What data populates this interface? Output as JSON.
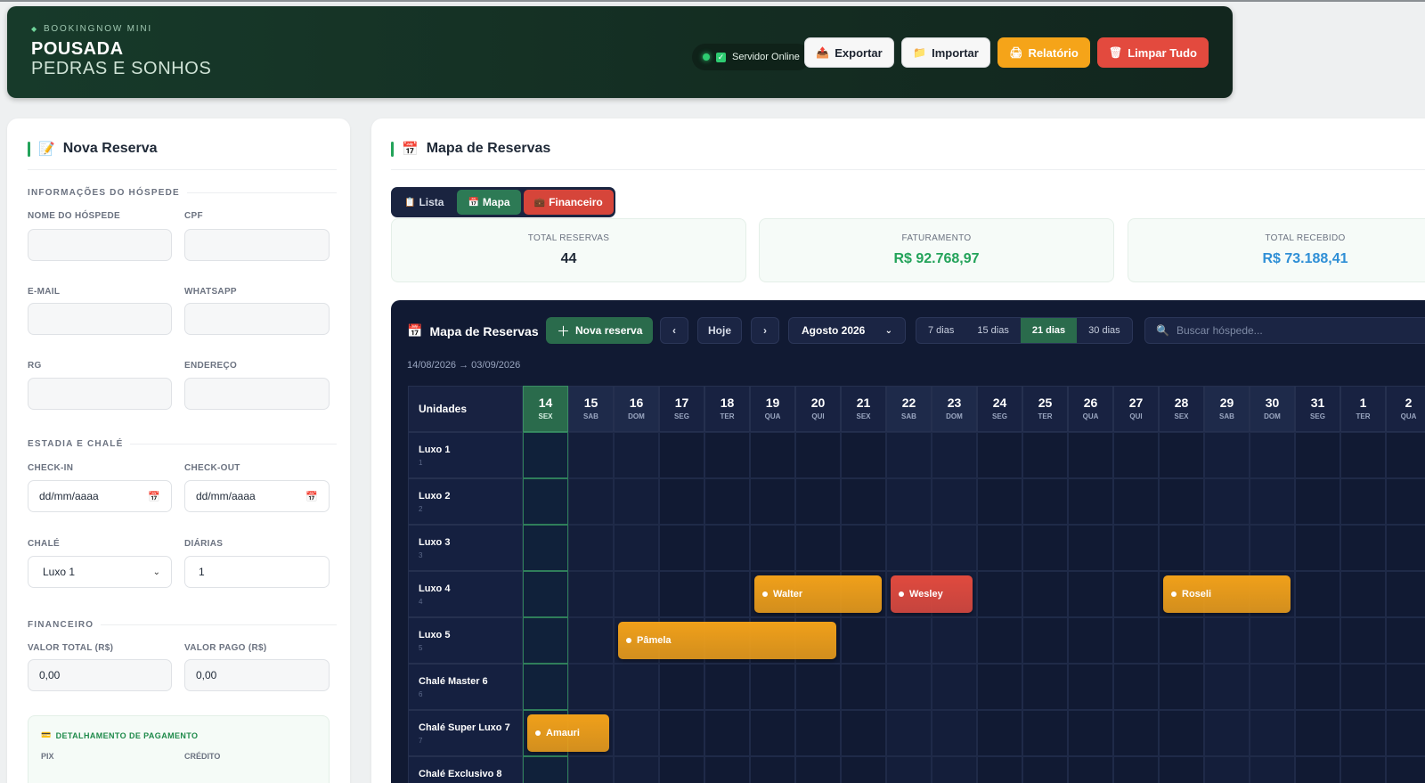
{
  "header": {
    "brand_sub": "BOOKINGNOW MINI",
    "title_line1": "POUSADA",
    "title_line2": "PEDRAS E SONHOS",
    "server_status": "Servidor Online",
    "buttons": {
      "export": "Exportar",
      "import": "Importar",
      "report": "Relatório",
      "clear": "Limpar Tudo"
    },
    "colors": {
      "orange": "#f5a419",
      "red": "#e34a3e",
      "bg": "#173a2a"
    }
  },
  "form": {
    "title": "Nova Reserva",
    "guest_section": "INFORMAÇÕES DO HÓSPEDE",
    "labels": {
      "name": "NOME DO HÓSPEDE",
      "cpf": "CPF",
      "email": "E-MAIL",
      "whatsapp": "WHATSAPP",
      "rg": "RG",
      "address": "ENDEREÇO",
      "checkin": "CHECK-IN",
      "checkout": "CHECK-OUT",
      "chalet": "CHALÉ",
      "nights": "DIÁRIAS",
      "total_value": "VALOR TOTAL (R$)",
      "paid_value": "VALOR PAGO (R$)"
    },
    "stay_section": "ESTADIA E CHALÉ",
    "finance_section": "FINANCEIRO",
    "values": {
      "checkin": "dd/mm/aaaa",
      "checkout": "dd/mm/aaaa",
      "chalet": "Luxo 1",
      "nights": "1",
      "total_value": "0,00",
      "paid_value": "0,00"
    },
    "payment": {
      "title": "DETALHAMENTO DE PAGAMENTO",
      "col_pix": "PIX",
      "col_credit": "CRÉDITO"
    }
  },
  "main": {
    "title": "Mapa de Reservas",
    "tabs": [
      {
        "label": "Lista"
      },
      {
        "label": "Mapa"
      },
      {
        "label": "Financeiro"
      }
    ],
    "stats": [
      {
        "label": "TOTAL RESERVAS",
        "value": "44",
        "color": "#1f2937"
      },
      {
        "label": "FATURAMENTO",
        "value": "R$ 92.768,97",
        "color": "#23a35a"
      },
      {
        "label": "TOTAL RECEBIDO",
        "value": "R$ 73.188,41",
        "color": "#2f8fd6"
      }
    ]
  },
  "map": {
    "title": "Mapa de Reservas",
    "new_button": "Nova reserva",
    "prev": "‹",
    "today": "Hoje",
    "next": "›",
    "month": "Agosto 2026",
    "ranges": [
      "7 dias",
      "15 dias",
      "21 dias",
      "30 dias"
    ],
    "active_range": "21 dias",
    "search_placeholder": "Buscar hóspede...",
    "date_range": "14/08/2026 → 03/09/2026",
    "units_header": "Unidades",
    "days": [
      {
        "num": "14",
        "wk": "SEX",
        "today": true
      },
      {
        "num": "15",
        "wk": "SAB",
        "weekend": true
      },
      {
        "num": "16",
        "wk": "DOM",
        "weekend": true
      },
      {
        "num": "17",
        "wk": "SEG"
      },
      {
        "num": "18",
        "wk": "TER"
      },
      {
        "num": "19",
        "wk": "QUA"
      },
      {
        "num": "20",
        "wk": "QUI"
      },
      {
        "num": "21",
        "wk": "SEX"
      },
      {
        "num": "22",
        "wk": "SAB",
        "weekend": true
      },
      {
        "num": "23",
        "wk": "DOM",
        "weekend": true
      },
      {
        "num": "24",
        "wk": "SEG"
      },
      {
        "num": "25",
        "wk": "TER"
      },
      {
        "num": "26",
        "wk": "QUA"
      },
      {
        "num": "27",
        "wk": "QUI"
      },
      {
        "num": "28",
        "wk": "SEX"
      },
      {
        "num": "29",
        "wk": "SAB",
        "weekend": true
      },
      {
        "num": "30",
        "wk": "DOM",
        "weekend": true
      },
      {
        "num": "31",
        "wk": "SEG"
      },
      {
        "num": "1",
        "wk": "TER"
      },
      {
        "num": "2",
        "wk": "QUA"
      }
    ],
    "units": [
      {
        "name": "Luxo 1",
        "num": "1"
      },
      {
        "name": "Luxo 2",
        "num": "2"
      },
      {
        "name": "Luxo 3",
        "num": "3"
      },
      {
        "name": "Luxo 4",
        "num": "4"
      },
      {
        "name": "Luxo 5",
        "num": "5"
      },
      {
        "name": "Chalé Master 6",
        "num": "6"
      },
      {
        "name": "Chalé Super Luxo 7",
        "num": "7"
      },
      {
        "name": "Chalé Exclusivo 8",
        "num": "8"
      }
    ],
    "reservations": [
      {
        "guest": "Walter",
        "unit": 3,
        "start": 5,
        "days": 3,
        "color": "#f0a01a"
      },
      {
        "guest": "Wesley",
        "unit": 3,
        "start": 8,
        "days": 2,
        "color": "#e04a3e"
      },
      {
        "guest": "Roseli",
        "unit": 3,
        "start": 14,
        "days": 3,
        "color": "#f0a01a"
      },
      {
        "guest": "Pâmela",
        "unit": 4,
        "start": 2,
        "days": 5,
        "color": "#f0a01a"
      },
      {
        "guest": "Amauri",
        "unit": 6,
        "start": 0,
        "days": 2,
        "color": "#f0a01a"
      }
    ]
  }
}
